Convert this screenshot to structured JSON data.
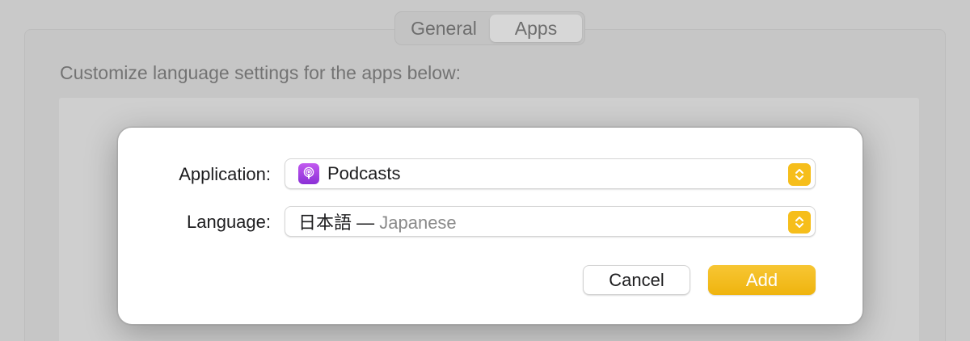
{
  "window": {
    "segments": [
      {
        "label": "General",
        "selected": false
      },
      {
        "label": "Apps",
        "selected": true
      }
    ],
    "description": "Customize language settings for the apps below:"
  },
  "dialog": {
    "application": {
      "label": "Application:",
      "value": "Podcasts",
      "icon": "podcasts-app-icon"
    },
    "language": {
      "label": "Language:",
      "native_name": "日本語 —",
      "english_name": "Japanese"
    },
    "cancel_label": "Cancel",
    "add_label": "Add"
  },
  "colors": {
    "accent": "#f2b818",
    "podcasts_icon": "#a544e6"
  }
}
